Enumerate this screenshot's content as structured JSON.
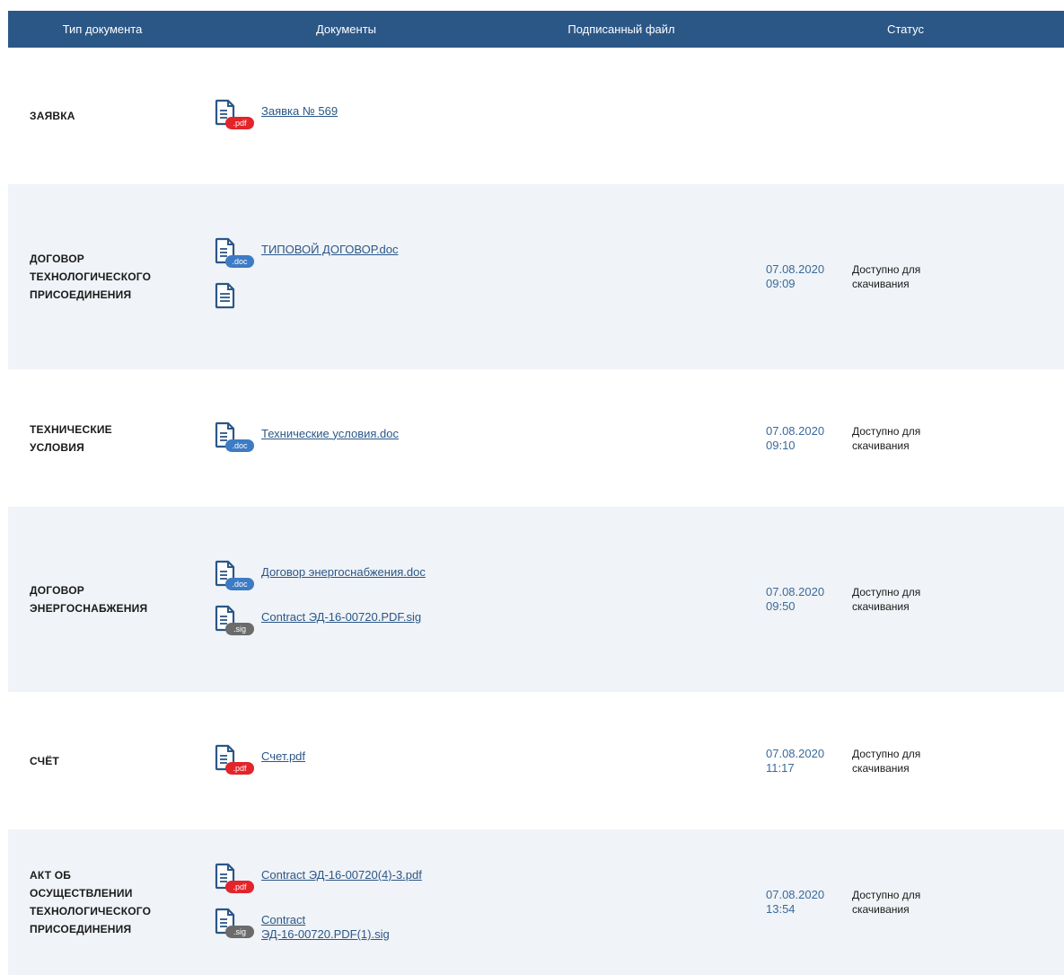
{
  "header": {
    "col_type": "Тип документа",
    "col_docs": "Документы",
    "col_signed": "Подписанный файл",
    "col_status": "Статус"
  },
  "rows": [
    {
      "type": "ЗАЯВКА",
      "docs": [
        {
          "name": "Заявка № 569",
          "badge": ".pdf",
          "icon": "pdf-file-icon"
        }
      ],
      "date": "",
      "status": ""
    },
    {
      "type": "ДОГОВОР\nТЕХНОЛОГИЧЕСКОГО\nПРИСОЕДИНЕНИЯ",
      "docs": [
        {
          "name": "ТИПОВОЙ ДОГОВОР.doc",
          "badge": ".doc",
          "icon": "doc-file-icon"
        },
        {
          "name": "",
          "badge": "",
          "icon": "file-icon"
        }
      ],
      "date": "07.08.2020\n09:09",
      "status": "Доступно для\nскачивания"
    },
    {
      "type": "ТЕХНИЧЕСКИЕ\nУСЛОВИЯ",
      "docs": [
        {
          "name": "Технические условия.doc",
          "badge": ".doc",
          "icon": "doc-file-icon"
        }
      ],
      "date": "07.08.2020\n09:10",
      "status": "Доступно для\nскачивания"
    },
    {
      "type": "ДОГОВОР\nЭНЕРГОСНАБЖЕНИЯ",
      "docs": [
        {
          "name": "Договор энергоснабжения.doc",
          "badge": ".doc",
          "icon": "doc-file-icon"
        },
        {
          "name": "Contract ЭД-16-00720.PDF.sig",
          "badge": ".sig",
          "icon": "sig-file-icon"
        }
      ],
      "date": "07.08.2020\n09:50",
      "status": "Доступно для\nскачивания"
    },
    {
      "type": "СЧЁТ",
      "docs": [
        {
          "name": "Счет.pdf",
          "badge": ".pdf",
          "icon": "pdf-file-icon"
        }
      ],
      "date": "07.08.2020\n11:17",
      "status": "Доступно для\nскачивания"
    },
    {
      "type": "АКТ ОБ\nОСУЩЕСТВЛЕНИИ\nТЕХНОЛОГИЧЕСКОГО\nПРИСОЕДИНЕНИЯ",
      "docs": [
        {
          "name": "Contract ЭД-16-00720(4)-3.pdf",
          "badge": ".pdf",
          "icon": "pdf-file-icon"
        },
        {
          "name": "Contract\nЭД-16-00720.PDF(1).sig",
          "badge": ".sig",
          "icon": "sig-file-icon"
        }
      ],
      "date": "07.08.2020\n13:54",
      "status": "Доступно для\nскачивания"
    }
  ],
  "colors": {
    "header_bg": "#2b5787",
    "link": "#2b5787",
    "alt_row": "#f0f3f7",
    "pdf": "#e2242b",
    "doc": "#3d7bc4",
    "sig": "#6b6b6b"
  }
}
